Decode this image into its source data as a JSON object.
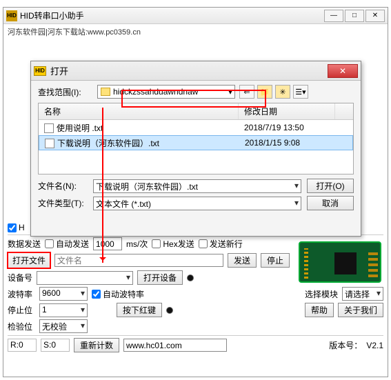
{
  "main": {
    "app_badge": "HID",
    "title": "HID转串口小助手",
    "url_text": "河东软件园|河东下载站:www.pc0359.cn",
    "watermark": "www.pc0359.cn",
    "win_min": "—",
    "win_max": "□",
    "win_close": "✕"
  },
  "dialog": {
    "badge": "HID",
    "title": "打开",
    "close": "✕",
    "lookin_label": "查找范围(I):",
    "current_dir": "hidckzssahduawndnaw",
    "icons": {
      "back": "⇐",
      "up": "📁",
      "new": "✳",
      "view": "☰▾"
    },
    "header_name": "名称",
    "header_date": "修改日期",
    "files": [
      {
        "name": "使用说明 .txt",
        "date": "2018/7/19 13:50",
        "selected": false
      },
      {
        "name": "下载说明（河东软件园）.txt",
        "date": "2018/1/15 9:08",
        "selected": true
      }
    ],
    "filename_label": "文件名(N):",
    "filename_value": "下载说明（河东软件园）.txt",
    "filetype_label": "文件类型(T):",
    "filetype_value": "文本文件 (*.txt)",
    "open_btn": "打开(O)",
    "cancel_btn": "取消"
  },
  "panel": {
    "hidusb_cb": "H",
    "data_send_label": "数据发送",
    "auto_send": "自动发送",
    "interval": "1000",
    "interval_unit": "ms/次",
    "hex_send": "Hex发送",
    "send_newline": "发送新行",
    "open_file": "打开文件",
    "file_placeholder": "文件名",
    "send_btn": "发送",
    "stop_btn": "停止",
    "device_label": "设备号",
    "open_device": "打开设备",
    "baud_label": "波特率",
    "baud_value": "9600",
    "auto_baud": "自动波特率",
    "stopbit_label": "停止位",
    "stopbit_value": "1",
    "press_red": "按下红键",
    "check_label": "检验位",
    "check_value": "无校验",
    "select_module": "选择模块",
    "select_value": "请选择",
    "help_btn": "帮助",
    "about_btn": "关于我们",
    "r_label": "R:0",
    "s_label": "S:0",
    "reset_count": "重新计数",
    "site": "www.hc01.com",
    "version_label": "版本号：",
    "version": "V2.1"
  }
}
